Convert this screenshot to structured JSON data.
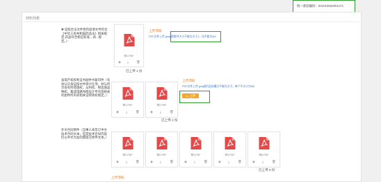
{
  "header": {
    "id_label": "统一查验编码：",
    "id_value": "001015520001171"
  },
  "panel": {
    "title": "材料列表"
  },
  "sections": [
    {
      "label": "✱ 证照合法文件性内容清文件符合《中华人民共和国药品法》相关规定,药品符合相应标准,...具...规定。）：",
      "upload_tip": "上传须知:",
      "requirement": "文件大小不能为大于1，仅不能为5M",
      "requirement_prefix": "PDF文件上传 jpeg图片",
      "count_text": "已上传 1 份",
      "files": [
        {
          "name": "附1.PDF"
        }
      ]
    },
    {
      "label": "发现产权权利证书副件书复印件（有效认识身证按文件目计在项，并与所示会有所得施权、与利权、物造施品种权、集成电路布图设计专有等相关的副件所有权相关证明等权规定。）：",
      "upload_tip": "上传须知:",
      "requirement": "此处最大不能为大于，每个不大小为5M",
      "requirement_prefix": "PDF文件上传 jpeg图片",
      "upload_button": "上传",
      "count_text": "已上传 2 份",
      "files": [
        {
          "name": "附1.PDF"
        },
        {
          "name": "附2.PDF"
        }
      ]
    },
    {
      "label": "外文合同原件（当事人未签订中文技术合同文本，但其技术合同内容仍以中文为准的需提交原件文本。）",
      "count_text": "已上传 5 份",
      "files": [
        {
          "name": "附1.PDF"
        },
        {
          "name": "附2.PDF"
        },
        {
          "name": "附3.PDF"
        },
        {
          "name": "附4.PDF"
        },
        {
          "name": "附5.PDF"
        }
      ]
    },
    {
      "upload_tip": "上传须知:"
    }
  ],
  "icons": {
    "preview": "eye-icon",
    "download": "download-icon",
    "delete": "trash-icon"
  },
  "colors": {
    "accent_orange": "#e8832a",
    "pdf_red": "#e24a4a",
    "highlight_green": "#2f9e2f",
    "link_blue": "#3b76c8"
  }
}
